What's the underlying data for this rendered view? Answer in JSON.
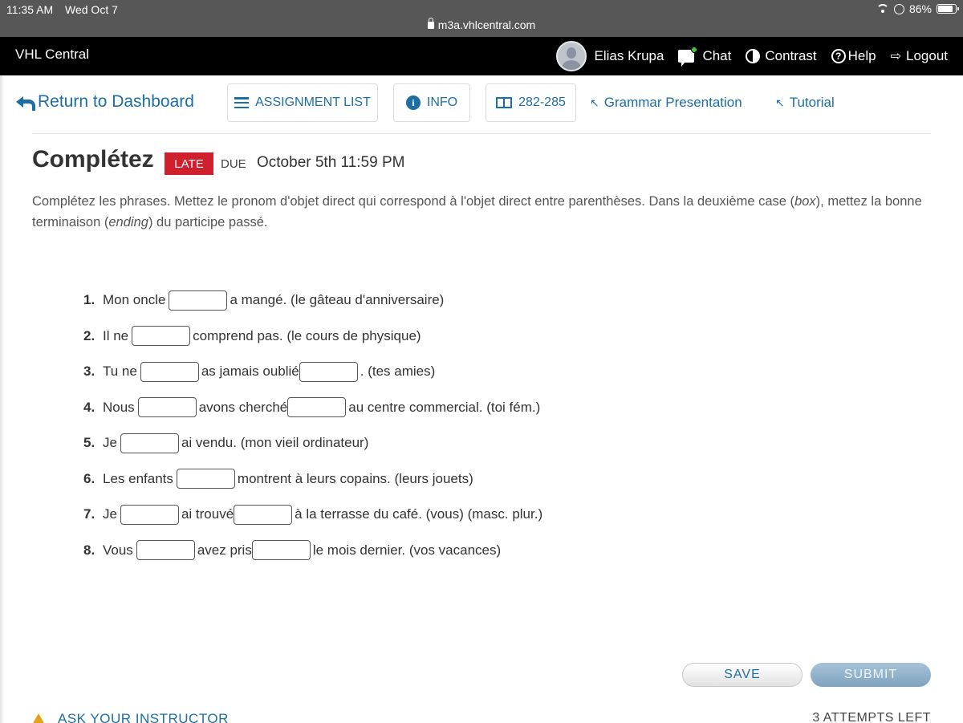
{
  "status_bar": {
    "time": "11:35 AM",
    "date": "Wed Oct 7",
    "url": "m3a.vhlcentral.com",
    "battery": "86%"
  },
  "header": {
    "brand": "VHL Central",
    "user_name": "Elias Krupa",
    "chat": "Chat",
    "contrast": "Contrast",
    "help": "Help",
    "logout": "Logout"
  },
  "subnav": {
    "back": "Return to Dashboard",
    "assignment_list": "ASSIGNMENT LIST",
    "info": "INFO",
    "pages": "282-285",
    "grammar": "Grammar Presentation",
    "tutorial": "Tutorial"
  },
  "activity": {
    "title": "Complétez",
    "late_badge": "LATE",
    "due_label": "DUE",
    "due_date": "October 5th 11:59 PM",
    "instructions_parts": [
      "Complétez les phrases. Mettez le pronom d'objet direct qui correspond à l'objet direct entre parenthèses. Dans la deuxième case (",
      "box",
      "), mettez la bonne terminaison (",
      "ending",
      ") du participe passé."
    ]
  },
  "questions": [
    {
      "num": "1.",
      "parts": [
        "Mon oncle",
        "a mangé. (le gâteau d'anniversaire)"
      ]
    },
    {
      "num": "2.",
      "parts": [
        "Il ne",
        "comprend pas. (le cours de physique)"
      ]
    },
    {
      "num": "3.",
      "parts": [
        "Tu ne",
        "as jamais oublié",
        ". (tes amies)"
      ]
    },
    {
      "num": "4.",
      "parts": [
        "Nous",
        "avons cherché",
        "au centre commercial. (toi fém.)"
      ]
    },
    {
      "num": "5.",
      "parts": [
        "Je",
        "ai vendu. (mon vieil ordinateur)"
      ]
    },
    {
      "num": "6.",
      "parts": [
        "Les enfants",
        "montrent à leurs copains. (leurs jouets)"
      ]
    },
    {
      "num": "7.",
      "parts": [
        "Je",
        "ai trouvé",
        "à la terrasse du café. (vous) (masc. plur.)"
      ]
    },
    {
      "num": "8.",
      "parts": [
        "Vous",
        "avez pris",
        "le mois dernier. (vos vacances)"
      ]
    }
  ],
  "footer": {
    "save": "SAVE",
    "submit": "SUBMIT",
    "ask": "ASK YOUR INSTRUCTOR",
    "attempts": "3 ATTEMPTS LEFT"
  },
  "colors": {
    "link_blue": "#1c6ea4",
    "late_red": "#d0202e",
    "header_black": "#000000"
  }
}
